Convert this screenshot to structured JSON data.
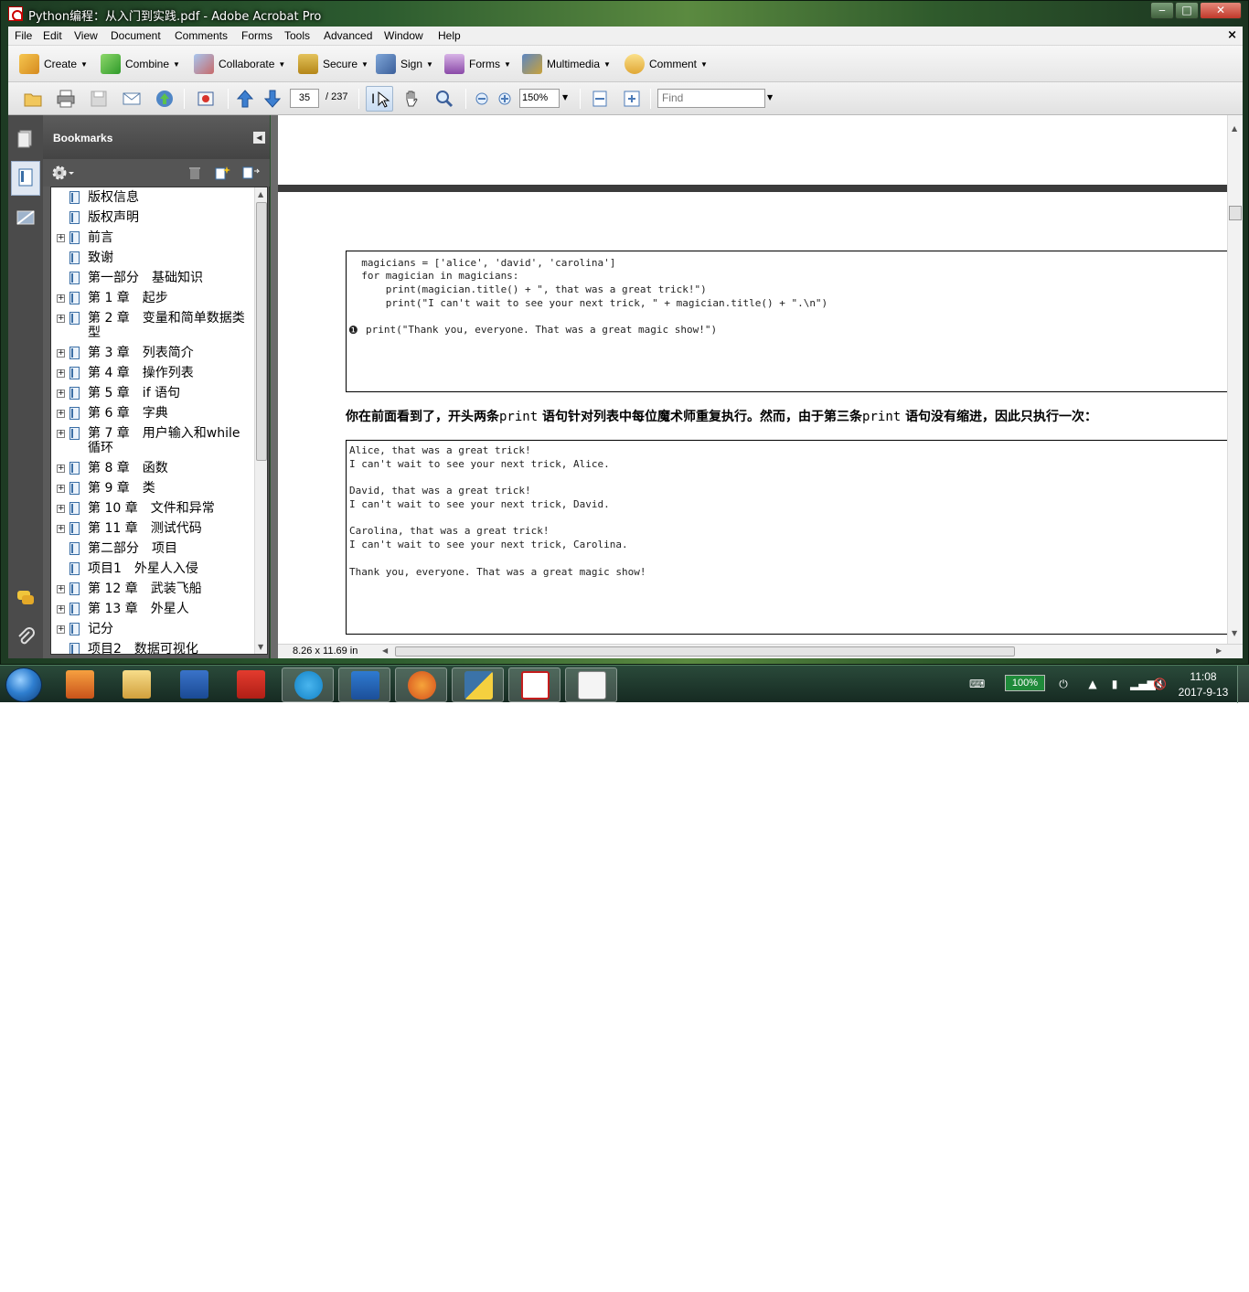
{
  "window": {
    "title": "Python编程：从入门到实践.pdf - Adobe Acrobat Pro"
  },
  "menubar": {
    "items": [
      "File",
      "Edit",
      "View",
      "Document",
      "Comments",
      "Forms",
      "Tools",
      "Advanced",
      "Window",
      "Help"
    ],
    "close": "×"
  },
  "tasks": {
    "items": [
      "Create",
      "Combine",
      "Collaborate",
      "Secure",
      "Sign",
      "Forms",
      "Multimedia",
      "Comment"
    ]
  },
  "nav": {
    "page_current": "35",
    "page_total": "/ 237",
    "zoom": "150%",
    "find_placeholder": "Find"
  },
  "bookmarks": {
    "title": "Bookmarks",
    "items": [
      {
        "label": "版权信息",
        "expandable": false
      },
      {
        "label": "版权声明",
        "expandable": false
      },
      {
        "label": "前言",
        "expandable": true
      },
      {
        "label": "致谢",
        "expandable": false
      },
      {
        "label": "第一部分　基础知识",
        "expandable": false
      },
      {
        "label": "第 1 章　起步",
        "expandable": true
      },
      {
        "label": "第 2 章　变量和简单数据类型",
        "expandable": true
      },
      {
        "label": "第 3 章　列表简介",
        "expandable": true
      },
      {
        "label": "第 4 章　操作列表",
        "expandable": true
      },
      {
        "label": "第 5 章　if 语句",
        "expandable": true
      },
      {
        "label": "第 6 章　字典",
        "expandable": true
      },
      {
        "label": "第 7 章　用户输入和while循环",
        "expandable": true
      },
      {
        "label": "第 8 章　函数",
        "expandable": true
      },
      {
        "label": "第 9 章　类",
        "expandable": true
      },
      {
        "label": "第 10 章　文件和异常",
        "expandable": true
      },
      {
        "label": "第 11 章　测试代码",
        "expandable": true
      },
      {
        "label": "第二部分　项目",
        "expandable": false
      },
      {
        "label": "项目1　外星人入侵",
        "expandable": false
      },
      {
        "label": "第 12 章　武装飞船",
        "expandable": true
      },
      {
        "label": "第 13 章　外星人",
        "expandable": true
      },
      {
        "label": "记分",
        "expandable": true
      },
      {
        "label": "项目2　数据可视化",
        "expandable": false
      }
    ]
  },
  "document": {
    "code_lines": [
      "  magicians = ['alice', 'david', 'carolina']",
      "  for magician in magicians:",
      "      print(magician.title() + \", that was a great trick!\")",
      "      print(\"I can't wait to see your next trick, \" + magician.title() + \".\\n\")"
    ],
    "code_marker": "❶",
    "code_marker_line": "print(\"Thank you, everyone. That was a great magic show!\")",
    "para_part1": "你在前面看到了，开头两条",
    "para_code1": "print",
    "para_part2": "语句针对列表中每位魔术师重复执行。然而，由于第三条",
    "para_code2": "print",
    "para_part3": "语句没有缩进，因此只执行一次：",
    "output_lines": [
      "Alice, that was a great trick!",
      "I can't wait to see your next trick, Alice.",
      "",
      "David, that was a great trick!",
      "I can't wait to see your next trick, David.",
      "",
      "Carolina, that was a great trick!",
      "I can't wait to see your next trick, Carolina.",
      "",
      "Thank you, everyone. That was a great magic show!"
    ],
    "page_size": "8.26 x 11.69 in"
  },
  "taskbar": {
    "battery": "100%",
    "time": "11:08",
    "date": "2017-9-13"
  },
  "colors": {
    "accent": "#3a6ea5",
    "window_frame": "#2c5b2f",
    "battery": "#1f8a3a"
  }
}
